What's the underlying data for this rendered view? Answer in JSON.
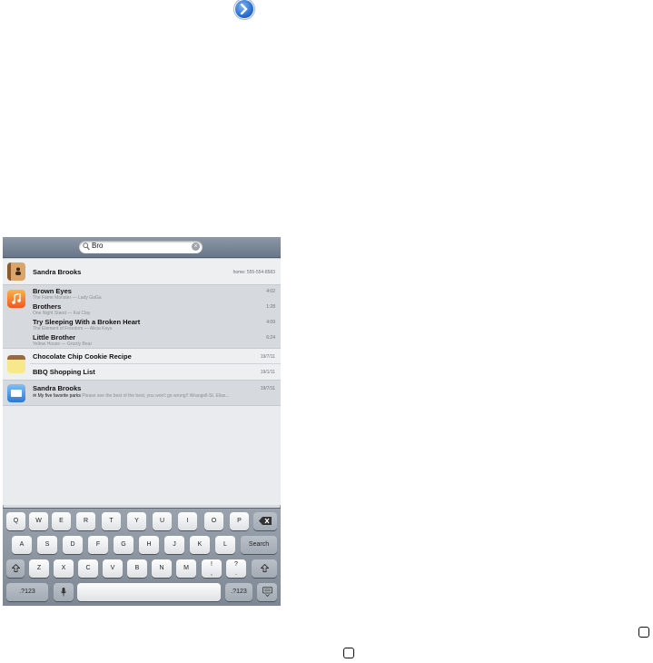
{
  "search": {
    "query": "Bro"
  },
  "results": {
    "contacts": [
      {
        "name": "Sandra Brooks",
        "detail": "home: 555-554-8583"
      }
    ],
    "music": [
      {
        "title": "Brown Eyes",
        "subtitle": "The Fame Monster — Lady GaGa",
        "time": "4:02"
      },
      {
        "title": "Brothers",
        "subtitle": "One Night Stand — Kai Clay",
        "time": "1:28"
      },
      {
        "title": "Try Sleeping With a Broken Heart",
        "subtitle": "The Element of Freedom — Alicia Keys",
        "time": "4:09"
      },
      {
        "title": "Little Brother",
        "subtitle": "Yellow House — Grizzly Bear",
        "time": "6:24"
      }
    ],
    "notes": [
      {
        "title": "Chocolate Chip Cookie Recipe",
        "date": "19/7/11"
      },
      {
        "title": "BBQ Shopping List",
        "date": "19/1/11"
      }
    ],
    "mail": [
      {
        "sender": "Sandra Brooks",
        "date": "19/7/11",
        "subject": "✉ My five favorite parks",
        "snippet": "Please see the best of the best, you won't go wrong!! Wrangell-St. Elias..."
      }
    ]
  },
  "keyboard": {
    "row1": [
      "Q",
      "W",
      "E",
      "R",
      "T",
      "Y",
      "U",
      "I",
      "O",
      "P"
    ],
    "row2": [
      "A",
      "S",
      "D",
      "F",
      "G",
      "H",
      "J",
      "K",
      "L"
    ],
    "row3": [
      "Z",
      "X",
      "C",
      "V",
      "B",
      "N",
      "M"
    ],
    "row3_punct": [
      {
        "top": "!",
        "bottom": ","
      },
      {
        "top": "?",
        "bottom": "."
      }
    ],
    "search_label": "Search",
    "numbers_label": ".?123"
  },
  "icons": {
    "top": "chevron-right-circle-icon",
    "delete": "backspace-icon",
    "shift": "shift-icon",
    "mic": "microphone-icon",
    "hide": "keyboard-dismiss-icon",
    "home": "home-button-icon"
  }
}
